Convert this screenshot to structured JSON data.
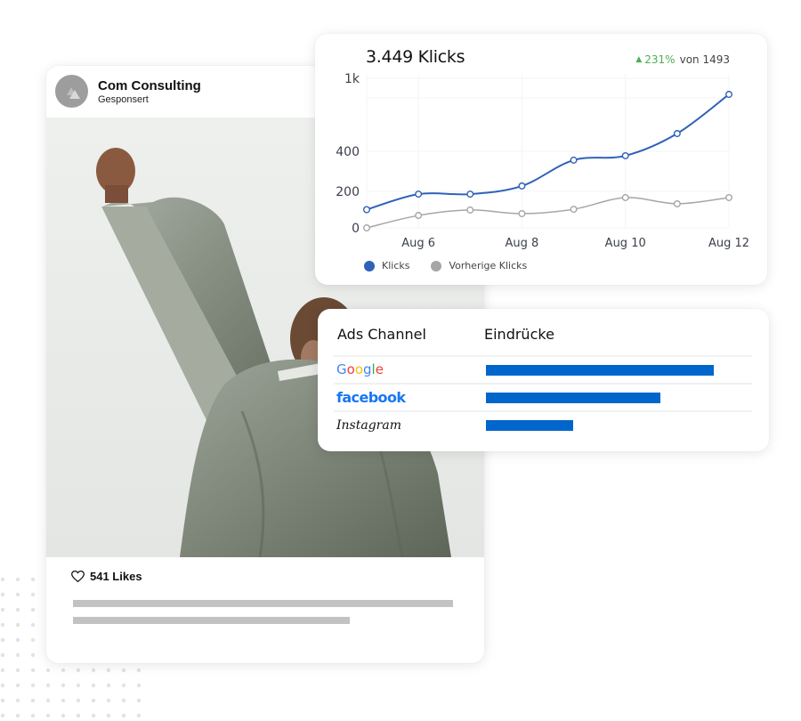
{
  "post": {
    "author": "Com Consulting",
    "subtitle": "Gesponsert",
    "likes_label": "541 Likes",
    "icons": {
      "avatar": "triangle-logo-icon",
      "like": "heart-outline-icon"
    }
  },
  "clicks_card": {
    "total_label": "3.449 Klicks",
    "change_pct": "231%",
    "change_direction": "up",
    "compare_label": "von 1493",
    "colors": {
      "positive": "#4caf50",
      "current": "#2f62b8",
      "previous": "#a6a6a6"
    }
  },
  "chart_data": {
    "type": "line",
    "title": "3.449 Klicks",
    "xlabel": "",
    "ylabel": "",
    "x": [
      "Aug 5",
      "Aug 6",
      "Aug 7",
      "Aug 8",
      "Aug 9",
      "Aug 10",
      "Aug 11",
      "Aug 12"
    ],
    "x_tick_labels": [
      "Aug 6",
      "Aug 8",
      "Aug 10",
      "Aug 12"
    ],
    "y_tick_labels": [
      "0",
      "200",
      "400",
      "1k"
    ],
    "y_ticks": [
      0,
      200,
      400,
      1000
    ],
    "ylim": [
      0,
      1000
    ],
    "grid": true,
    "legend_position": "bottom-left",
    "series": [
      {
        "name": "Klicks",
        "color": "#2f62b8",
        "values": [
          100,
          185,
          185,
          227,
          356,
          378,
          546,
          868
        ]
      },
      {
        "name": "Vorherige Klicks",
        "color": "#a6a6a6",
        "values": [
          0,
          68,
          98,
          78,
          102,
          166,
          132,
          166
        ]
      }
    ]
  },
  "ads_table": {
    "headers": {
      "channel": "Ads Channel",
      "impressions": "Eindrücke"
    },
    "bar_color": "#0066cc",
    "rows": [
      {
        "channel": "Google",
        "impressions_share": 0.853
      },
      {
        "channel": "facebook",
        "impressions_share": 0.653
      },
      {
        "channel": "Instagram",
        "impressions_share": 0.327
      }
    ]
  }
}
